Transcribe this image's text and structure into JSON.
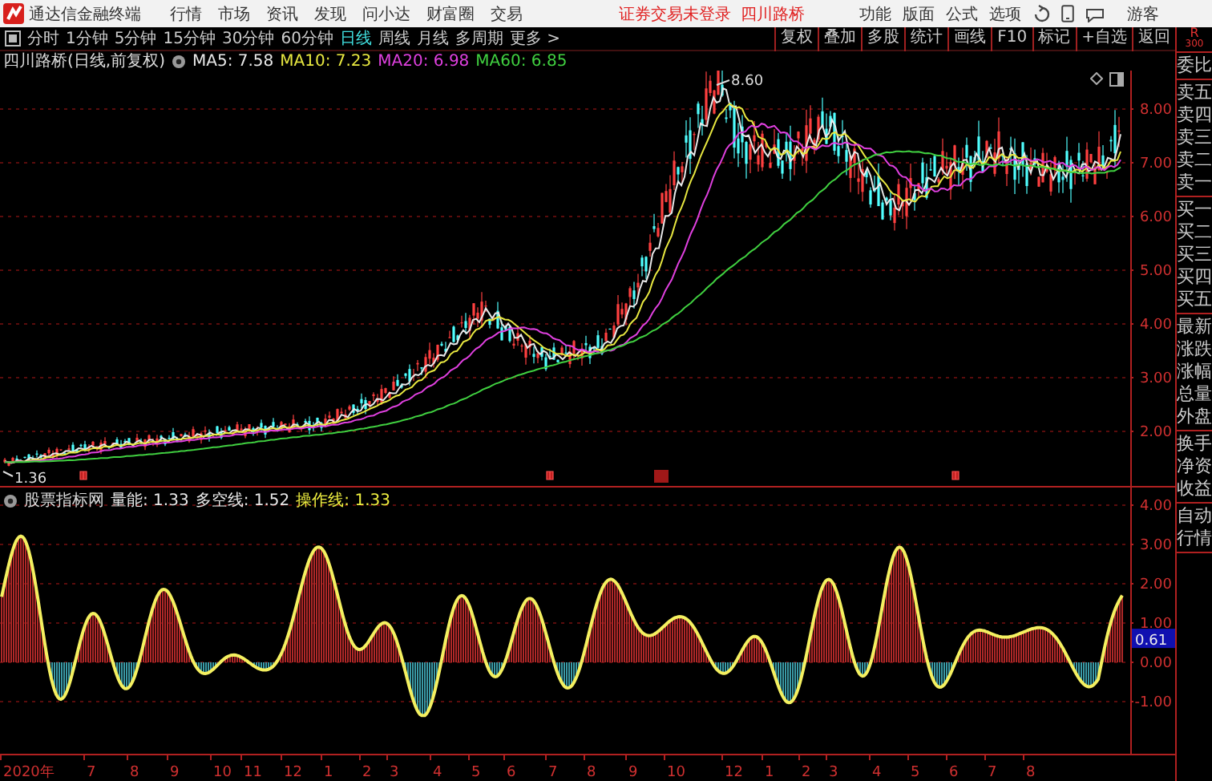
{
  "title_bar": {
    "app_name": "通达信金融终端",
    "menus": [
      "行情",
      "市场",
      "资讯",
      "发现",
      "问小达",
      "财富圈",
      "交易"
    ],
    "login_status": "证券交易未登录",
    "stock_name": "四川路桥",
    "functions": [
      "功能",
      "版面",
      "公式",
      "选项"
    ],
    "user": "游客"
  },
  "toolbar": {
    "periods": [
      {
        "label": "分时",
        "selected": false
      },
      {
        "label": "1分钟",
        "selected": false
      },
      {
        "label": "5分钟",
        "selected": false
      },
      {
        "label": "15分钟",
        "selected": false
      },
      {
        "label": "30分钟",
        "selected": false
      },
      {
        "label": "60分钟",
        "selected": false
      },
      {
        "label": "日线",
        "selected": true
      },
      {
        "label": "周线",
        "selected": false
      },
      {
        "label": "月线",
        "selected": false
      },
      {
        "label": "多周期",
        "selected": false
      },
      {
        "label": "更多 >",
        "selected": false
      }
    ],
    "buttons": [
      "复权",
      "叠加",
      "多股",
      "统计",
      "画线",
      "F10",
      "标记",
      "+自选",
      "返回"
    ]
  },
  "main_chart": {
    "title": "四川路桥(日线,前复权)",
    "moving_averages": [
      {
        "label": "MA5: 7.58",
        "color": "#e8e8e8"
      },
      {
        "label": "MA10: 7.23",
        "color": "#e8e840"
      },
      {
        "label": "MA20: 6.98",
        "color": "#e040e0"
      },
      {
        "label": "MA60: 6.85",
        "color": "#40d040"
      }
    ],
    "high_label": "8.60",
    "low_label": "1.36",
    "y_axis": [
      "8.00",
      "7.00",
      "6.00",
      "5.00",
      "4.00",
      "3.00",
      "2.00"
    ]
  },
  "indicator": {
    "name": "股票指标网",
    "values": [
      {
        "label": "量能: 1.33",
        "color": "#e8e8e8"
      },
      {
        "label": "多空线: 1.52",
        "color": "#e8e8e8"
      },
      {
        "label": "操作线: 1.33",
        "color": "#f0f040"
      }
    ],
    "current_value": "0.61",
    "y_axis": [
      "4.00",
      "3.00",
      "2.00",
      "1.00",
      "0.00",
      "-1.00"
    ]
  },
  "x_axis": [
    "2020年",
    "7",
    "8",
    "9",
    "10",
    "11",
    "12",
    "1",
    "2",
    "3",
    "4",
    "5",
    "6",
    "7",
    "8",
    "9",
    "10",
    "12",
    "1",
    "2",
    "3",
    "4",
    "5",
    "6",
    "7",
    "8"
  ],
  "quote_panel": {
    "header": [
      "R",
      "300"
    ],
    "groups": [
      [
        "委比"
      ],
      [
        "卖五",
        "卖四",
        "卖三",
        "卖二",
        "卖一"
      ],
      [
        "买一",
        "买二",
        "买三",
        "买四",
        "买五"
      ],
      [
        "最新",
        "涨跌",
        "涨幅",
        "总量",
        "外盘"
      ],
      [
        "换手",
        "净资",
        "收益"
      ],
      [
        "自动",
        "行情"
      ]
    ]
  }
}
